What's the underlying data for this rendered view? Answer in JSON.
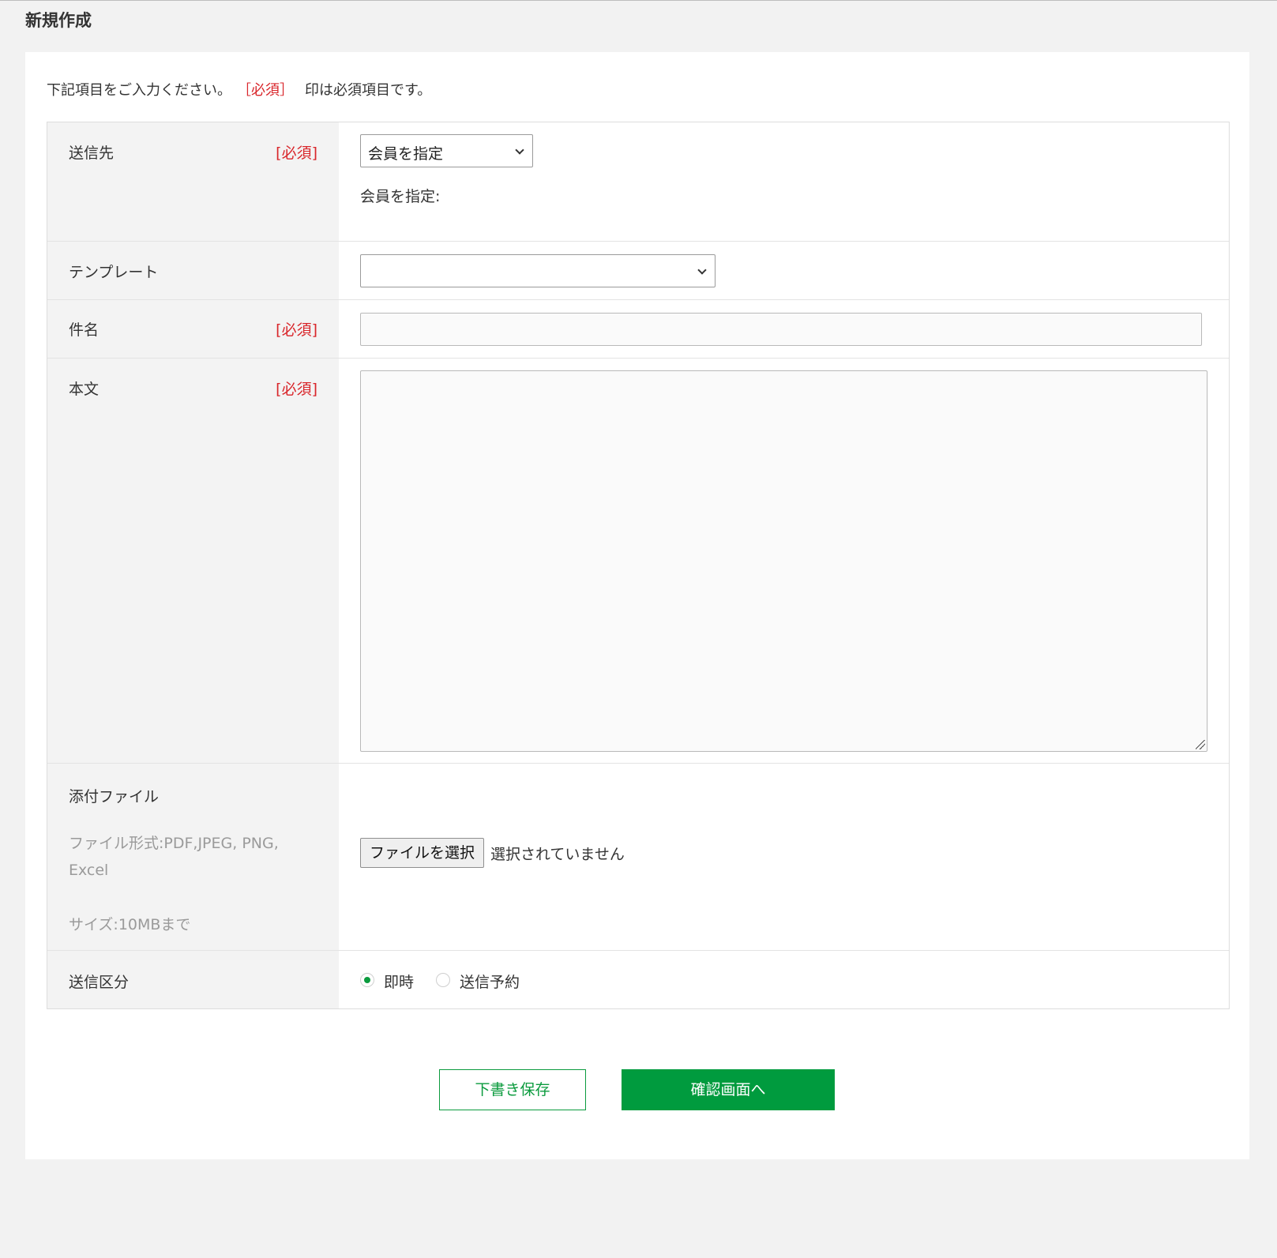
{
  "page": {
    "title": "新規作成"
  },
  "intro": {
    "before": "下記項目をご入力ください。",
    "required": "［必須］",
    "after": "印は必須項目です。"
  },
  "required_mark": "[必須]",
  "fields": {
    "recipient": {
      "label": "送信先",
      "select_value": "会員を指定",
      "member_label": "会員を指定:"
    },
    "template": {
      "label": "テンプレート",
      "select_value": ""
    },
    "subject": {
      "label": "件名",
      "value": ""
    },
    "body": {
      "label": "本文",
      "value": ""
    },
    "attachment": {
      "label": "添付ファイル",
      "format_note_line1": "ファイル形式:PDF,JPEG, PNG,",
      "format_note_line2": "Excel",
      "size_note": "サイズ:10MBまで",
      "button_label": "ファイルを選択",
      "status": "選択されていません"
    },
    "send_type": {
      "label": "送信区分",
      "options": [
        {
          "label": "即時",
          "checked": true
        },
        {
          "label": "送信予約",
          "checked": false
        }
      ]
    }
  },
  "actions": {
    "draft_label": "下書き保存",
    "confirm_label": "確認画面へ"
  },
  "colors": {
    "accent": "#009b3e",
    "required": "#d9262b"
  }
}
